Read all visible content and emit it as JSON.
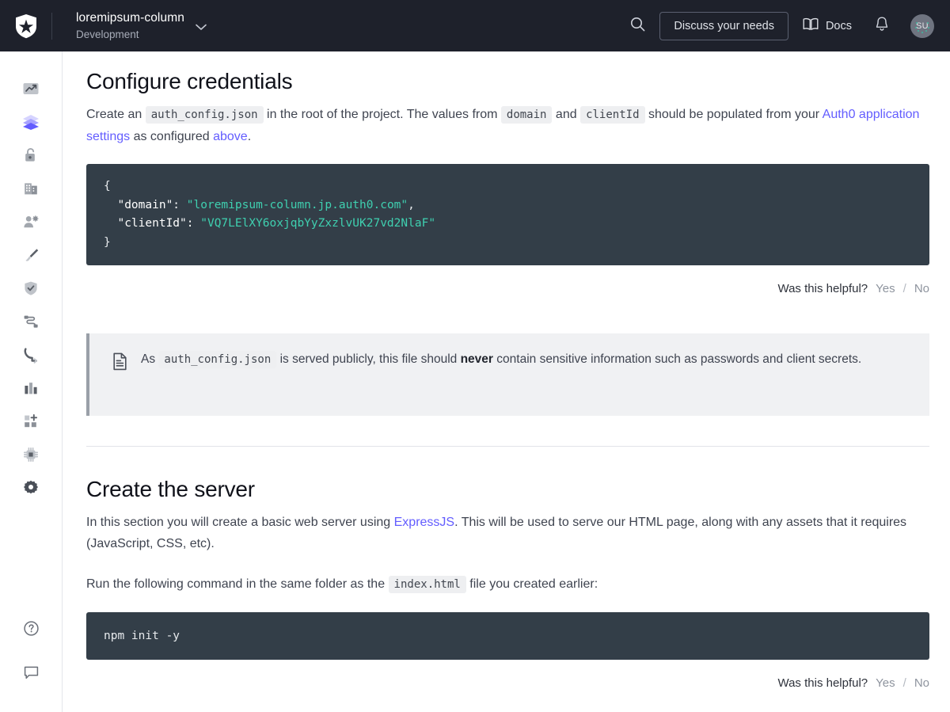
{
  "topbar": {
    "logo_icon": "auth0-shield-logo",
    "tenant_name": "loremipsum-column",
    "tenant_env": "Development",
    "tenant_chevron_icon": "chevron-down-icon",
    "search_icon": "search-icon",
    "discuss_label": "Discuss your needs",
    "docs_icon": "book-icon",
    "docs_label": "Docs",
    "notifications_icon": "bell-icon",
    "avatar_initials": "SU"
  },
  "sidebar": {
    "items": [
      {
        "icon": "activity-trend-icon",
        "name": "getting-started",
        "active": false
      },
      {
        "icon": "layers-icon",
        "name": "applications",
        "active": true
      },
      {
        "icon": "unlocked-padlock-icon",
        "name": "authentication",
        "active": false
      },
      {
        "icon": "organizations-building-icon",
        "name": "organizations",
        "active": false
      },
      {
        "icon": "user-management-icon",
        "name": "user-management",
        "active": false
      },
      {
        "icon": "paintbrush-icon",
        "name": "branding",
        "active": false
      },
      {
        "icon": "shield-check-icon",
        "name": "security",
        "active": false
      },
      {
        "icon": "flow-actions-icon",
        "name": "actions",
        "active": false
      },
      {
        "icon": "phone-hook-icon",
        "name": "auth-pipeline",
        "active": false
      },
      {
        "icon": "bar-chart-icon",
        "name": "monitoring",
        "active": false
      },
      {
        "icon": "marketplace-plus-icon",
        "name": "marketplace",
        "active": false
      },
      {
        "icon": "chip-icon",
        "name": "extensions",
        "active": false
      },
      {
        "icon": "gear-icon",
        "name": "settings",
        "active": false
      }
    ],
    "bottom_items": [
      {
        "icon": "help-circle-icon",
        "name": "help"
      },
      {
        "icon": "chat-bubble-icon",
        "name": "feedback"
      }
    ]
  },
  "main": {
    "section1": {
      "title": "Configure credentials",
      "paragraph": {
        "t1": "Create an ",
        "code1": "auth_config.json",
        "t2": " in the root of the project. The values from ",
        "code2": "domain",
        "t3": " and ",
        "code3": "clientId",
        "t4": " should be populated from your ",
        "link1": "Auth0 application settings",
        "t5": " as configured ",
        "link2": "above",
        "t6": "."
      },
      "code_block": {
        "line1": "{",
        "line2_key": "\"domain\":",
        "line2_val": "\"loremipsum-column.jp.auth0.com\"",
        "line2_comma": ",",
        "line3_key": "\"clientId\":",
        "line3_val": "\"VQ7LElXY6oxjqbYyZxzlvUK27vd2NlaF\"",
        "line4": "}"
      },
      "helpful": {
        "question": "Was this helpful?",
        "yes": "Yes",
        "slash": "/",
        "no": "No"
      }
    },
    "callout": {
      "icon": "document-file-icon",
      "t1": "As ",
      "code1": "auth_config.json",
      "t2": " is served publicly, this file should ",
      "bold": "never",
      "t3": " contain sensitive information such as passwords and client secrets."
    },
    "section2": {
      "title": "Create the server",
      "paragraph1": {
        "t1": "In this section you will create a basic web server using ",
        "link1": "ExpressJS",
        "t2": ". This will be used to serve our HTML page, along with any assets that it requires (JavaScript, CSS, etc)."
      },
      "paragraph2": {
        "t1": "Run the following command in the same folder as the ",
        "code1": "index.html",
        "t2": " file you created earlier:"
      },
      "code_block": {
        "line1": "npm init -y"
      },
      "helpful": {
        "question": "Was this helpful?",
        "yes": "Yes",
        "slash": "/",
        "no": "No"
      }
    }
  },
  "colors": {
    "topbar_bg": "#1e212b",
    "code_bg": "#333e48",
    "code_string": "#3fd0b0",
    "link": "#635dff",
    "callout_bg": "#f0f1f3",
    "callout_border": "#9aa0a8",
    "accent_active": "#635dff"
  }
}
